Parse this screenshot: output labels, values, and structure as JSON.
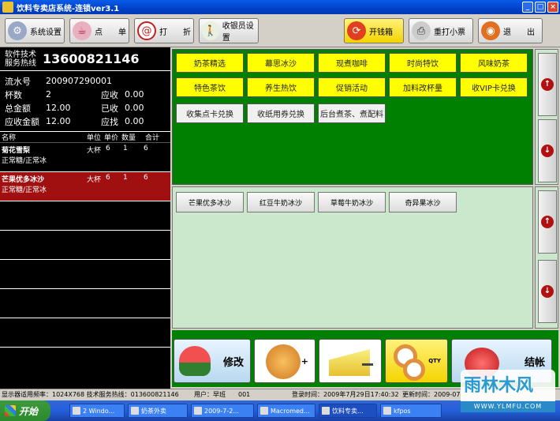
{
  "window": {
    "title": "饮料专卖店系统-连锁ver3.1"
  },
  "toolbar": {
    "settings": "系统设置",
    "order": "点　　单",
    "discount": "打　　折",
    "cashier": "收银员设置",
    "drawer": "开钱箱",
    "reprint": "重打小票",
    "exit": "退　　出"
  },
  "hotline": {
    "label": "软件技术服务热线",
    "number": "13600821146"
  },
  "order": {
    "serial_label": "流水号",
    "serial": "200907290001",
    "cups_label": "杯数",
    "cups": "2",
    "receivable_label": "应收",
    "receivable": "0.00",
    "total_label": "总金额",
    "total": "12.00",
    "received_label": "已收",
    "received": "0.00",
    "due_label": "应收金额",
    "due": "12.00",
    "change_label": "应找",
    "change": "0.00"
  },
  "items_header": {
    "name": "名称",
    "unit": "单位",
    "price": "单价",
    "qty": "数量",
    "sum": "合计"
  },
  "items": [
    {
      "name": "菊花雪梨",
      "note": "正常糖/正常冰",
      "unit": "大杯",
      "price": "6",
      "qty": "1",
      "sum": "6"
    },
    {
      "name": "芒果优多冰沙",
      "note": "正常糖/正常冰",
      "unit": "大杯",
      "price": "6",
      "qty": "1",
      "sum": "6"
    }
  ],
  "categories": [
    "奶茶精选",
    "幕思冰沙",
    "现煮咖啡",
    "时尚特饮",
    "风味奶茶",
    "特色茶饮",
    "养生热饮",
    "促销活动",
    "加料改杯量",
    "收VIP卡兑换",
    "收集点卡兑换",
    "收纸用券兑换",
    "后台煮茶、煮配料"
  ],
  "products": [
    "芒果优多冰沙",
    "红豆牛奶冰沙",
    "草莓牛奶冰沙",
    "奇异果冰沙"
  ],
  "actions": {
    "modify": "修改",
    "checkout": "结帐",
    "qty_badge": "QTY"
  },
  "status": {
    "resolution": "显示器适用频率：1024X768 技术服务热线：013600821146",
    "user": "用户：早班　　001",
    "login": "登录时间：2009年7月29日17:40:32",
    "update": "更新时间：2009-07"
  },
  "taskbar": {
    "start": "开始",
    "tasks": [
      "2 Windo...",
      "奶茶外卖",
      "2009-7-2...",
      "Macromed...",
      "饮料专卖...",
      "kfpos"
    ]
  },
  "watermark": {
    "text": "雨林木风",
    "url": "WWW.YLMFU.COM"
  }
}
